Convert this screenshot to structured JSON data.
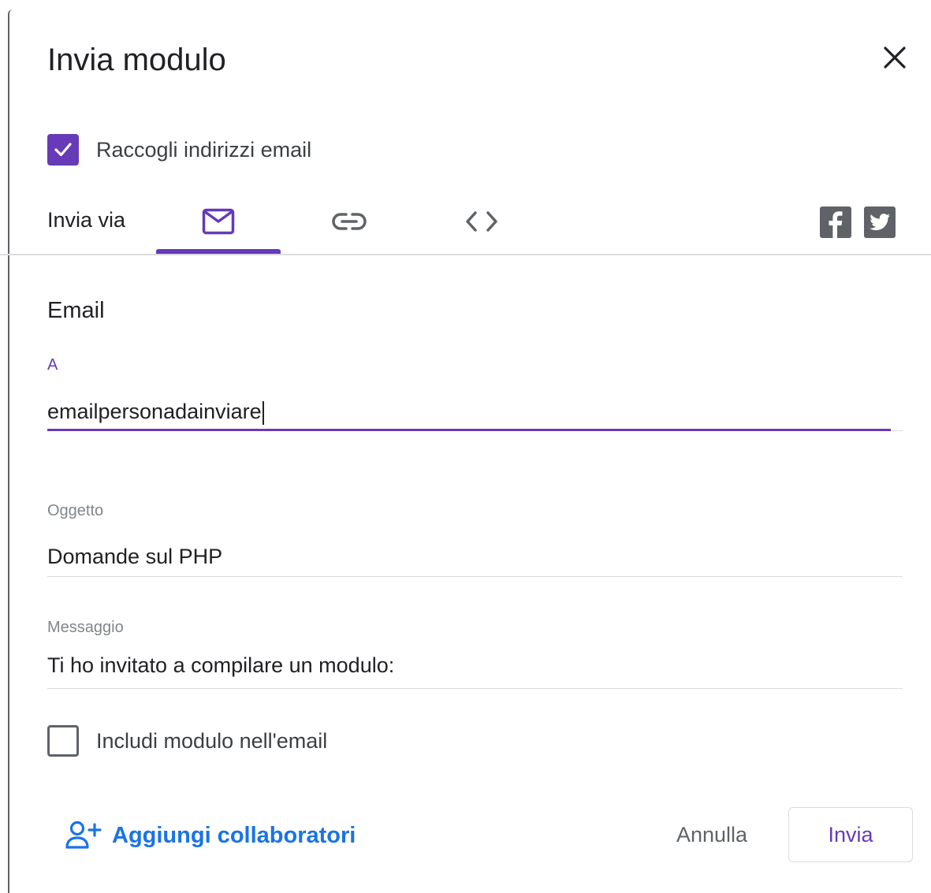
{
  "dialog": {
    "title": "Invia modulo",
    "close_icon": "close-icon"
  },
  "collect_emails": {
    "label": "Raccogli indirizzi email",
    "checked": true
  },
  "send_via": {
    "label": "Invia via",
    "tabs": [
      {
        "icon": "envelope-icon",
        "selected": true
      },
      {
        "icon": "link-icon",
        "selected": false
      },
      {
        "icon": "embed-code-icon",
        "selected": false
      }
    ],
    "social": [
      {
        "icon": "facebook-icon"
      },
      {
        "icon": "twitter-icon"
      }
    ]
  },
  "email_form": {
    "section_title": "Email",
    "to": {
      "label": "A",
      "value": "emailpersonadainviare"
    },
    "subject": {
      "label": "Oggetto",
      "value": "Domande sul PHP"
    },
    "message": {
      "label": "Messaggio",
      "value": "Ti ho invitato a compilare un modulo:"
    },
    "include_form": {
      "label": "Includi modulo nell'email",
      "checked": false
    }
  },
  "footer": {
    "add_collaborators_label": "Aggiungi collaboratori",
    "cancel_label": "Annulla",
    "send_label": "Invia"
  },
  "colors": {
    "accent": "#673ab7",
    "link": "#1a73e8",
    "text": "#202124",
    "muted": "#80868b",
    "divider": "#dadce0"
  }
}
